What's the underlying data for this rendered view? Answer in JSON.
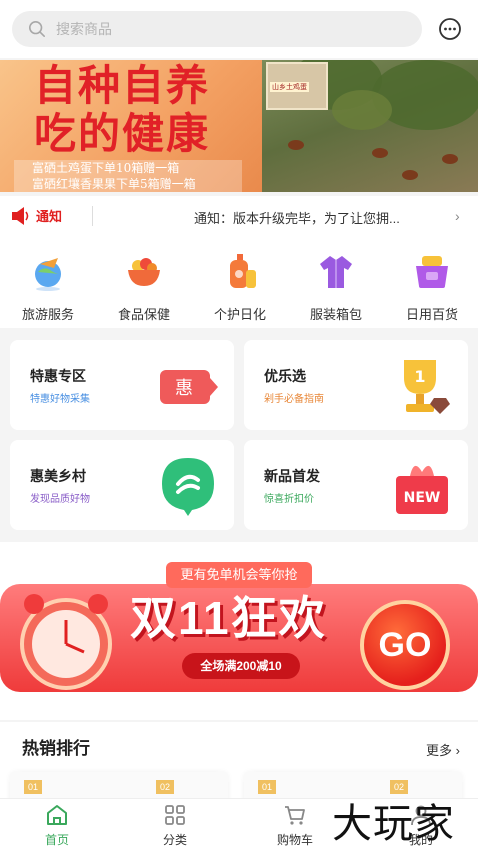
{
  "search": {
    "placeholder": "搜索商品"
  },
  "header": {
    "message_icon": "chat-bubble-icon"
  },
  "banner": {
    "title_line1": "自种自养",
    "title_line2": "吃的健康",
    "sub_line1": "富硒土鸡蛋下单10箱赠一箱",
    "sub_line2": "富硒红壤香果果下单5箱赠一箱",
    "photo_label": "山乡土鸡蛋"
  },
  "notice": {
    "label": "通知",
    "text": "通知：版本升级完毕，为了让您拥..."
  },
  "categories": [
    {
      "name": "旅游服务",
      "icon": "travel-icon"
    },
    {
      "name": "食品保健",
      "icon": "food-icon"
    },
    {
      "name": "个护日化",
      "icon": "personal-care-icon"
    },
    {
      "name": "服装箱包",
      "icon": "clothing-icon"
    },
    {
      "name": "日用百货",
      "icon": "daily-goods-icon"
    }
  ],
  "promo_cards": [
    {
      "title": "特惠专区",
      "subtitle": "特惠好物采集",
      "subtitle_color": "#4a90e2",
      "badge": "惠"
    },
    {
      "title": "优乐选",
      "subtitle": "剁手必备指南",
      "subtitle_color": "#e8883a",
      "badge": "1"
    },
    {
      "title": "惠美乡村",
      "subtitle": "发现品质好物",
      "subtitle_color": "#8a5ec8",
      "badge": ""
    },
    {
      "title": "新品首发",
      "subtitle": "惊喜折扣价",
      "subtitle_color": "#3aa85c",
      "badge": "NEW"
    }
  ],
  "promo_banner": {
    "top_text": "更有免单机会等你抢",
    "main_text": "双11狂欢",
    "pill_text": "全场满200减10",
    "go_text": "GO"
  },
  "hot": {
    "title": "热销排行",
    "more": "更多",
    "ranks": [
      "01",
      "02",
      "01",
      "02"
    ]
  },
  "tabbar": [
    {
      "label": "首页",
      "icon": "home-icon",
      "active": true
    },
    {
      "label": "分类",
      "icon": "grid-icon",
      "active": false
    },
    {
      "label": "购物车",
      "icon": "cart-icon",
      "active": false
    },
    {
      "label": "我的",
      "icon": "user-icon",
      "active": false
    }
  ],
  "watermark": "大玩家",
  "colors": {
    "accent_green": "#3aa85c",
    "notice_red": "#e02020",
    "promo_red": "#ef3b3b"
  }
}
